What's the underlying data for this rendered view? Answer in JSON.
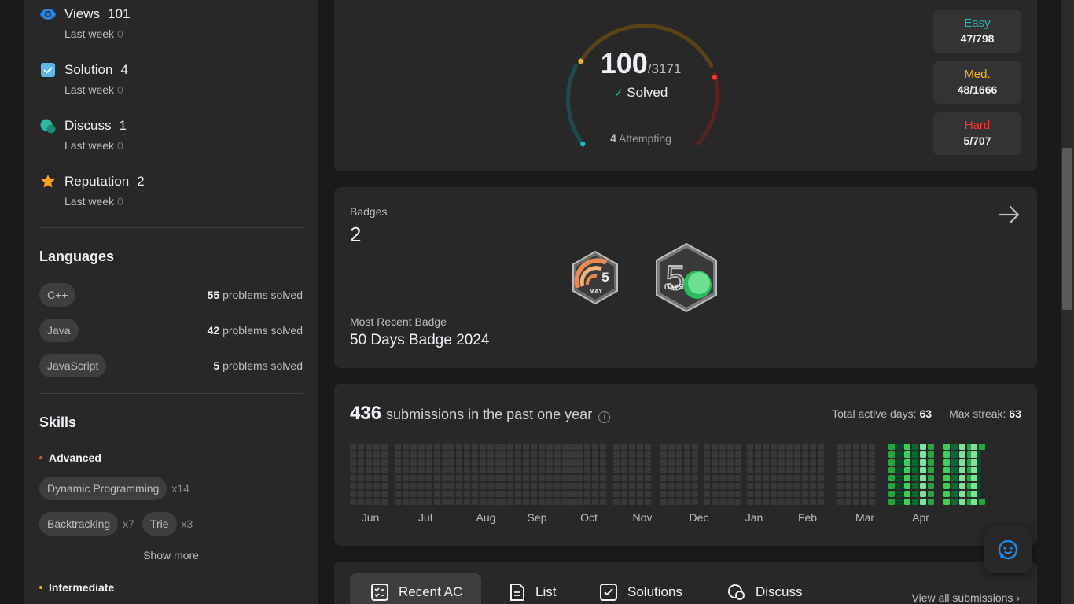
{
  "community": {
    "views": {
      "label": "Views",
      "value": "101",
      "sub": "Last week",
      "sub_value": "0"
    },
    "solution": {
      "label": "Solution",
      "value": "4",
      "sub": "Last week",
      "sub_value": "0"
    },
    "discuss": {
      "label": "Discuss",
      "value": "1",
      "sub": "Last week",
      "sub_value": "0"
    },
    "reputation": {
      "label": "Reputation",
      "value": "2",
      "sub": "Last week",
      "sub_value": "0"
    }
  },
  "languages": {
    "title": "Languages",
    "items": [
      {
        "name": "C++",
        "count": "55",
        "suffix": "problems solved"
      },
      {
        "name": "Java",
        "count": "42",
        "suffix": "problems solved"
      },
      {
        "name": "JavaScript",
        "count": "5",
        "suffix": "problems solved"
      }
    ]
  },
  "skills": {
    "title": "Skills",
    "advanced": {
      "label": "Advanced",
      "color": "#ef4743"
    },
    "items": [
      {
        "name": "Dynamic Programming",
        "count": "x14"
      },
      {
        "name": "Backtracking",
        "count": "x7"
      },
      {
        "name": "Trie",
        "count": "x3"
      }
    ],
    "show_more": "Show more",
    "intermediate": {
      "label": "Intermediate",
      "color": "#ffb700"
    }
  },
  "progress": {
    "solved": "100",
    "total": "/3171",
    "solved_label": "Solved",
    "attempting_count": "4",
    "attempting_label": "Attempting",
    "easy": {
      "label": "Easy",
      "value": "47/798",
      "color": "#1cbaba",
      "fraction": 0.0589
    },
    "medium": {
      "label": "Med.",
      "value": "48/1666",
      "color": "#ffb700",
      "fraction": 0.0288
    },
    "hard": {
      "label": "Hard",
      "value": "5/707",
      "color": "#f63737",
      "fraction": 0.0071
    }
  },
  "badges": {
    "label": "Badges",
    "count": "2",
    "most_recent_label": "Most Recent Badge",
    "most_recent_name": "50 Days Badge 2024",
    "badge1_text": "MAY",
    "badge1_num": "5",
    "badge2_text": "DAYS",
    "badge2_num": "50"
  },
  "submissions": {
    "count": "436",
    "text": "submissions in the past one year",
    "active_days_label": "Total active days:",
    "active_days": "63",
    "max_streak_label": "Max streak:",
    "max_streak": "63",
    "months": [
      "Jun",
      "Jul",
      "Aug",
      "Sep",
      "Oct",
      "Nov",
      "Dec",
      "Jan",
      "Feb",
      "Mar",
      "Apr"
    ]
  },
  "tabs": {
    "items": [
      "Recent AC",
      "List",
      "Solutions",
      "Discuss"
    ],
    "view_all": "View all submissions"
  },
  "colors": {
    "bg": "#1a1a1a",
    "card": "#282828",
    "accent_green": "#2cbb5d"
  }
}
